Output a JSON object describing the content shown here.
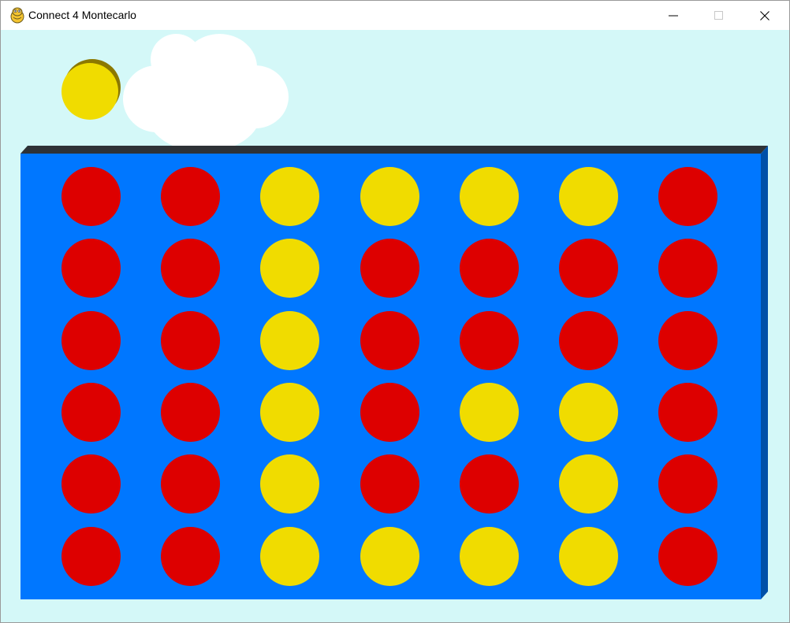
{
  "window": {
    "title": "Connect 4 Montecarlo",
    "icon": "python-snake-icon",
    "controls": [
      "minimize",
      "maximize",
      "close"
    ]
  },
  "game": {
    "current_piece_color": "yellow",
    "rows": 6,
    "columns": 7,
    "board": [
      [
        "red",
        "red",
        "yellow",
        "yellow",
        "yellow",
        "yellow",
        "red"
      ],
      [
        "red",
        "red",
        "yellow",
        "red",
        "red",
        "red",
        "red"
      ],
      [
        "red",
        "red",
        "yellow",
        "red",
        "red",
        "red",
        "red"
      ],
      [
        "red",
        "red",
        "yellow",
        "red",
        "yellow",
        "yellow",
        "red"
      ],
      [
        "red",
        "red",
        "yellow",
        "red",
        "red",
        "yellow",
        "red"
      ],
      [
        "red",
        "red",
        "yellow",
        "yellow",
        "yellow",
        "yellow",
        "red"
      ]
    ]
  },
  "colors": {
    "sky": "#d4f8f8",
    "board": "#0077ff",
    "board_side": "#0050a8",
    "board_top": "#2e3236",
    "red": "#dd0000",
    "yellow": "#f0dc00",
    "cloud": "#ffffff"
  }
}
